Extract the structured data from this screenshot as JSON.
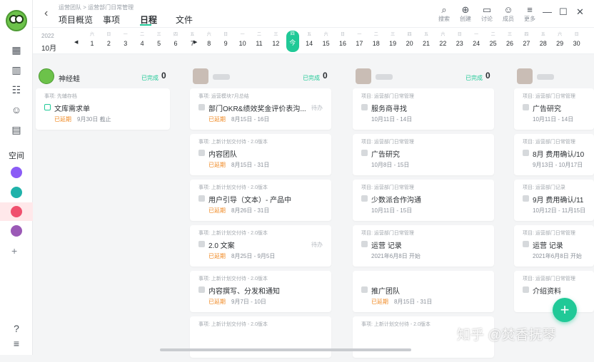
{
  "breadcrumb": "运营团队 > 运营部门日常管理",
  "tabs": [
    {
      "label": "项目概览"
    },
    {
      "label": "事项"
    },
    {
      "label": "日程"
    },
    {
      "label": "文件"
    }
  ],
  "toolbar": [
    {
      "icon": "search-icon",
      "label": "搜索"
    },
    {
      "icon": "plus-circle-icon",
      "label": "创建"
    },
    {
      "icon": "chat-icon",
      "label": "讨论"
    },
    {
      "icon": "members-icon",
      "label": "成员"
    },
    {
      "icon": "menu-icon",
      "label": "更多"
    }
  ],
  "sidebar": {
    "space_label": "空间"
  },
  "calendar": {
    "year": "2022",
    "month": "10月",
    "weekdays": [
      "六",
      "日",
      "一",
      "二",
      "三",
      "四",
      "五",
      "六",
      "日",
      "一",
      "二",
      "三",
      "四",
      "五",
      "六",
      "日",
      "一",
      "二",
      "三",
      "四",
      "五",
      "六",
      "日",
      "一",
      "二",
      "三",
      "四",
      "五",
      "六",
      "日"
    ],
    "days": [
      "1",
      "2",
      "3",
      "4",
      "5",
      "6",
      "7",
      "8",
      "9",
      "10",
      "11",
      "12",
      "今",
      "14",
      "15",
      "16",
      "17",
      "18",
      "19",
      "20",
      "21",
      "22",
      "23",
      "24",
      "25",
      "26",
      "27",
      "28",
      "29",
      "30"
    ],
    "today_weekday": "四"
  },
  "columns": [
    {
      "name": "神经蛙",
      "done_label": "已完成",
      "done_count": "0",
      "cards": [
        {
          "project": "事项: 先辅存档",
          "title": "文库需求单",
          "overdue": "已延期",
          "date": "9月30日 截止",
          "status": ""
        }
      ]
    },
    {
      "name": "",
      "done_label": "已完成",
      "done_count": "0",
      "cards": [
        {
          "project": "事项: 运营模块7月总结",
          "title": "部门OKR&绩效奖金评价表沟...",
          "overdue": "已延期",
          "date": "8月15日 - 16日",
          "status": "待办"
        },
        {
          "project": "事项: 上新计划交付待 - 2.0版本",
          "title": "内容团队",
          "overdue": "已延期",
          "date": "8月15日 - 31日",
          "status": ""
        },
        {
          "project": "事项: 上新计划交付待 - 2.0版本",
          "title": "用户引导（文本）- 产品中",
          "overdue": "已延期",
          "date": "8月26日 - 31日",
          "status": ""
        },
        {
          "project": "事项: 上新计划交付待 - 2.0版本",
          "title": "2.0 文案",
          "overdue": "已延期",
          "date": "8月25日 - 9月5日",
          "status": "待办"
        },
        {
          "project": "事项: 上新计划交付待 - 2.0版本",
          "title": "内容撰写、分发和通知",
          "overdue": "已延期",
          "date": "9月7日 - 10日",
          "status": ""
        },
        {
          "project": "事项: 上新计划交付待 - 2.0版本",
          "title": "",
          "overdue": "",
          "date": "",
          "status": ""
        }
      ]
    },
    {
      "name": "",
      "done_label": "已完成",
      "done_count": "0",
      "cards": [
        {
          "project": "项目: 运营部门日常管理",
          "title": "服务商寻找",
          "overdue": "",
          "date": "10月11日 - 14日",
          "status": ""
        },
        {
          "project": "项目: 运营部门日常管理",
          "title": "广告研究",
          "overdue": "",
          "date": "10月8日 - 15日",
          "status": ""
        },
        {
          "project": "项目: 运营部门日常管理",
          "title": "少数派合作沟通",
          "overdue": "",
          "date": "10月11日 - 15日",
          "status": ""
        },
        {
          "project": "项目: 运营部门日常管理",
          "title": "运营 记录",
          "overdue": "",
          "date": "2021年6月8日 开始",
          "status": ""
        },
        {
          "project": "",
          "title": "推广团队",
          "overdue": "已延期",
          "date": "8月15日 - 31日",
          "status": ""
        },
        {
          "project": "事项: 上新计划交付待 - 2.0版本",
          "title": "",
          "overdue": "",
          "date": "",
          "status": ""
        }
      ]
    },
    {
      "name": "",
      "done_label": "",
      "done_count": "",
      "cards": [
        {
          "project": "项目: 运营部门日常管理",
          "title": "广告研究",
          "overdue": "",
          "date": "10月11日 - 14日",
          "status": ""
        },
        {
          "project": "项目: 运营部门日常管理",
          "title": "8月 费用确认/10",
          "overdue": "",
          "date": "9月13日 - 10月17日",
          "status": ""
        },
        {
          "project": "项目: 运营部门记录",
          "title": "9月 费用确认/11",
          "overdue": "",
          "date": "10月12日 - 11月15日",
          "status": ""
        },
        {
          "project": "项目: 运营部门日常管理",
          "title": "运营 记录",
          "overdue": "",
          "date": "2021年6月8日 开始",
          "status": ""
        },
        {
          "project": "项目: 运营部门日常管理",
          "title": "介绍资料",
          "overdue": "",
          "date": "",
          "status": ""
        }
      ]
    }
  ],
  "fab_label": "+",
  "watermark": "知乎 @焚香抚琴"
}
